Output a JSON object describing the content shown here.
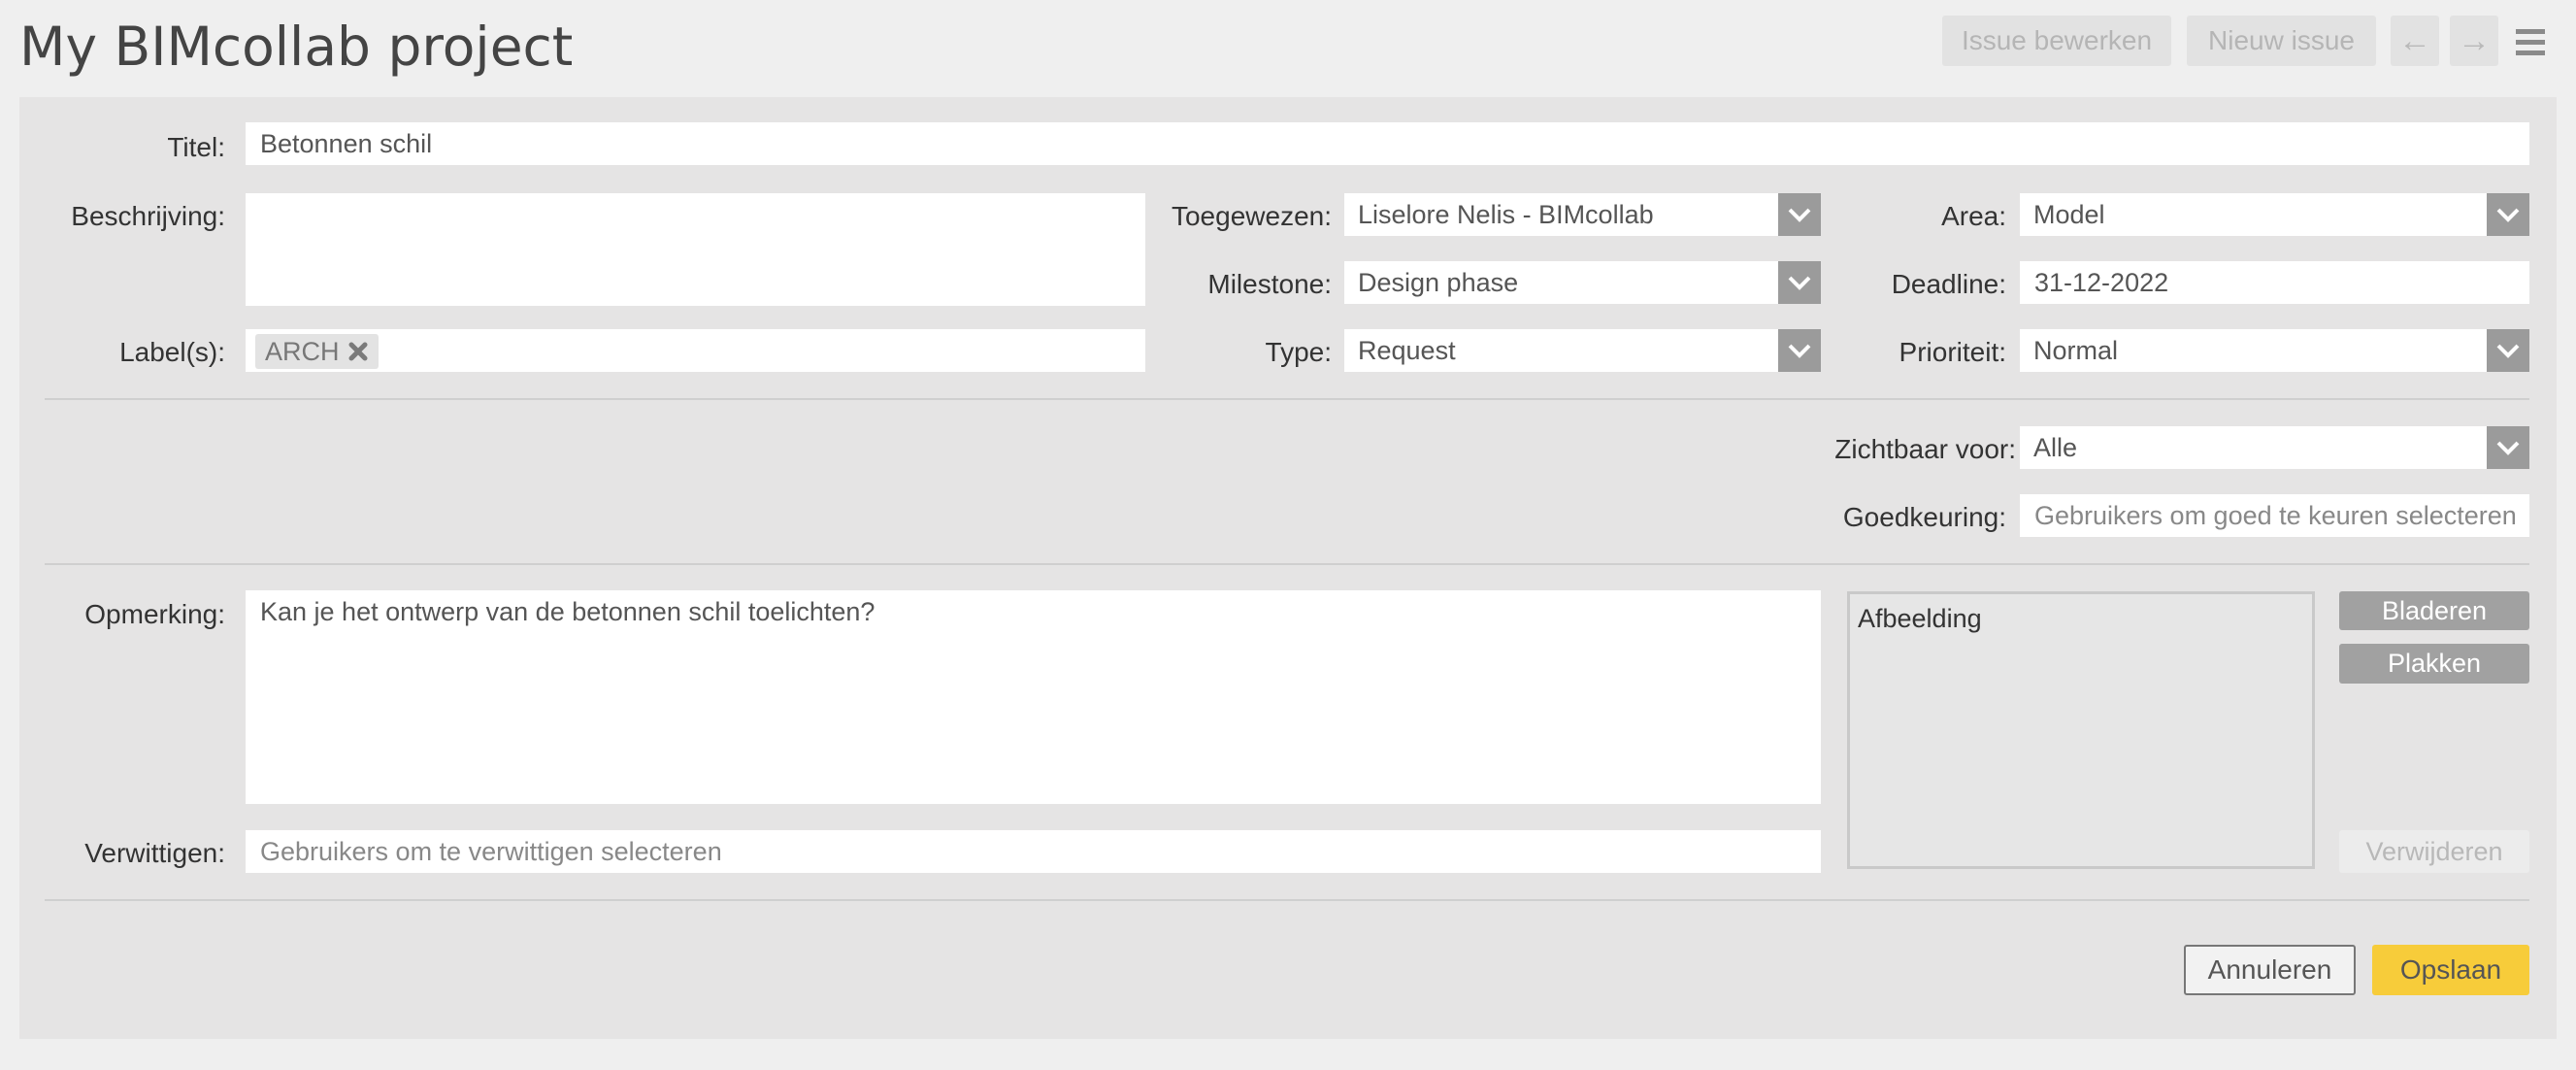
{
  "header": {
    "title": "My BIMcollab project",
    "edit_issue": "Issue bewerken",
    "new_issue": "Nieuw issue",
    "prev": "←",
    "next": "→"
  },
  "form": {
    "title": {
      "label": "Titel:",
      "value": "Betonnen schil"
    },
    "description": {
      "label": "Beschrijving:",
      "value": ""
    },
    "labels": {
      "label": "Label(s):",
      "tags": [
        "ARCH"
      ]
    },
    "assigned": {
      "label": "Toegewezen:",
      "value": "Liselore Nelis - BIMcollab"
    },
    "milestone": {
      "label": "Milestone:",
      "value": "Design phase"
    },
    "type": {
      "label": "Type:",
      "value": "Request"
    },
    "area": {
      "label": "Area:",
      "value": "Model"
    },
    "deadline": {
      "label": "Deadline:",
      "value": "31-12-2022"
    },
    "priority": {
      "label": "Prioriteit:",
      "value": "Normal"
    },
    "visible_for": {
      "label": "Zichtbaar voor:",
      "value": "Alle"
    },
    "approval": {
      "label": "Goedkeuring:",
      "placeholder": "Gebruikers om goed te keuren selecteren"
    },
    "comment": {
      "label": "Opmerking:",
      "value": "Kan je het ontwerp van de betonnen schil toelichten?"
    },
    "notify": {
      "label": "Verwittigen:",
      "placeholder": "Gebruikers om te verwittigen selecteren"
    }
  },
  "image": {
    "label": "Afbeelding",
    "browse": "Bladeren",
    "paste": "Plakken",
    "remove": "Verwijderen"
  },
  "actions": {
    "cancel": "Annuleren",
    "save": "Opslaan"
  },
  "colors": {
    "accent": "#f7cc3a",
    "caret": "#9b9b9b",
    "panel": "#e5e4e4"
  }
}
